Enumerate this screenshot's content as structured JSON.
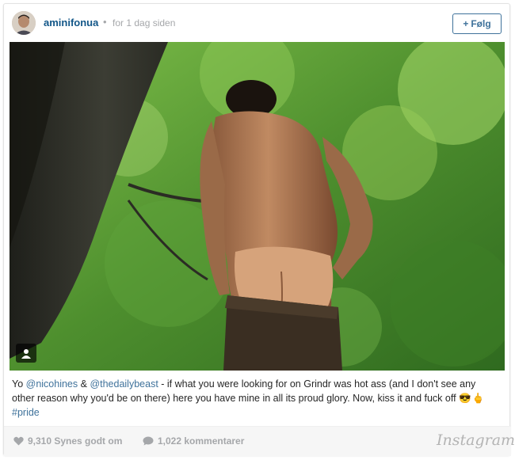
{
  "header": {
    "username": "aminifonua",
    "separator": "•",
    "time_ago": "for 1 dag siden",
    "follow_label": "Følg",
    "follow_prefix": "+"
  },
  "photo": {
    "alt_icon": "user-tag-icon"
  },
  "caption": {
    "prefix": "Yo ",
    "mention_1": "@nicohines",
    "amp": " & ",
    "mention_2": "@thedailybeast",
    "body": " - if what you were looking for on Grindr was hot ass (and I don't see any other reason why you'd be on there) here you have mine in all its proud glory. Now, kiss it and fuck off ",
    "emoji": "😎🖕",
    "hashtag": "#pride"
  },
  "footer": {
    "likes": "9,310 Synes godt om",
    "comments": "1,022 kommentarer",
    "brand": "Instagram"
  },
  "colors": {
    "link": "#3f729b",
    "username": "#125688",
    "muted": "#a5a7aa"
  }
}
